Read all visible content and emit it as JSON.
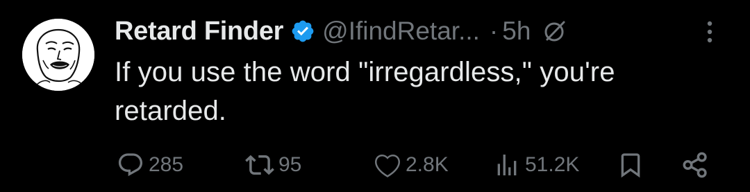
{
  "tweet": {
    "display_name": "Retard Finder",
    "handle": "@IfindRetar...",
    "separator": "·",
    "time": "5h",
    "text": "If you use the word \"irregardless,\" you're retarded."
  },
  "actions": {
    "replies": "285",
    "retweets": "95",
    "likes": "2.8K",
    "views": "51.2K"
  },
  "icons": {
    "verified": "verified-badge-icon",
    "grok": "grok-icon",
    "more": "more-vertical-icon",
    "reply": "reply-icon",
    "retweet": "retweet-icon",
    "like": "heart-icon",
    "views": "views-icon",
    "bookmark": "bookmark-icon",
    "share": "share-icon"
  },
  "colors": {
    "background": "#000000",
    "primary_text": "#e7e9ea",
    "secondary_text": "#71767b",
    "verified_blue": "#1d9bf0"
  }
}
